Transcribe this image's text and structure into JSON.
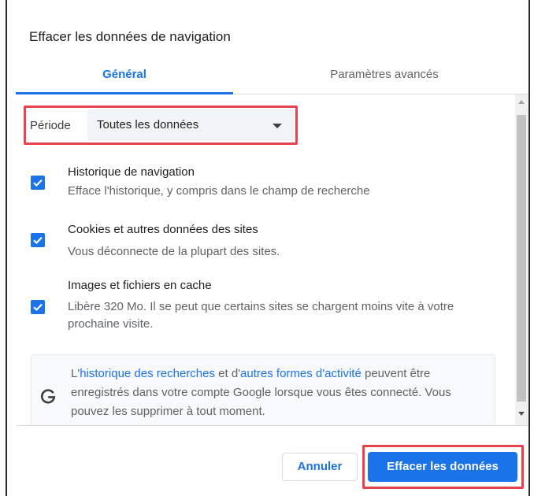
{
  "dialog": {
    "title": "Effacer les données de navigation"
  },
  "tabs": [
    {
      "label": "Général",
      "active": true
    },
    {
      "label": "Paramètres avancés",
      "active": false
    }
  ],
  "period": {
    "label": "Période",
    "selected": "Toutes les données"
  },
  "items": [
    {
      "title": "Historique de navigation",
      "description": "Efface l'historique, y compris dans le champ de recherche",
      "checked": true
    },
    {
      "title": "Cookies et autres données des sites",
      "description": "Vous déconnecte de la plupart des sites.",
      "checked": true
    },
    {
      "title": "Images et fichiers en cache",
      "description": "Libère 320 Mo. Il se peut que certains sites se chargent moins vite à votre prochaine visite.",
      "checked": true
    }
  ],
  "info": {
    "prefix": "L'",
    "link1": "historique des recherches",
    "middle": " et d'",
    "link2": "autres formes d'activité",
    "suffix": " peuvent être enregistrés dans votre compte Google lorsque vous êtes connecté. Vous pouvez les supprimer à tout moment."
  },
  "buttons": {
    "cancel": "Annuler",
    "clear": "Effacer les données"
  },
  "colors": {
    "accent": "#1a73e8",
    "highlight": "#e8424e"
  },
  "icons": {
    "info": "google-g-icon",
    "dropdown": "caret-down-icon",
    "check": "check-icon"
  }
}
